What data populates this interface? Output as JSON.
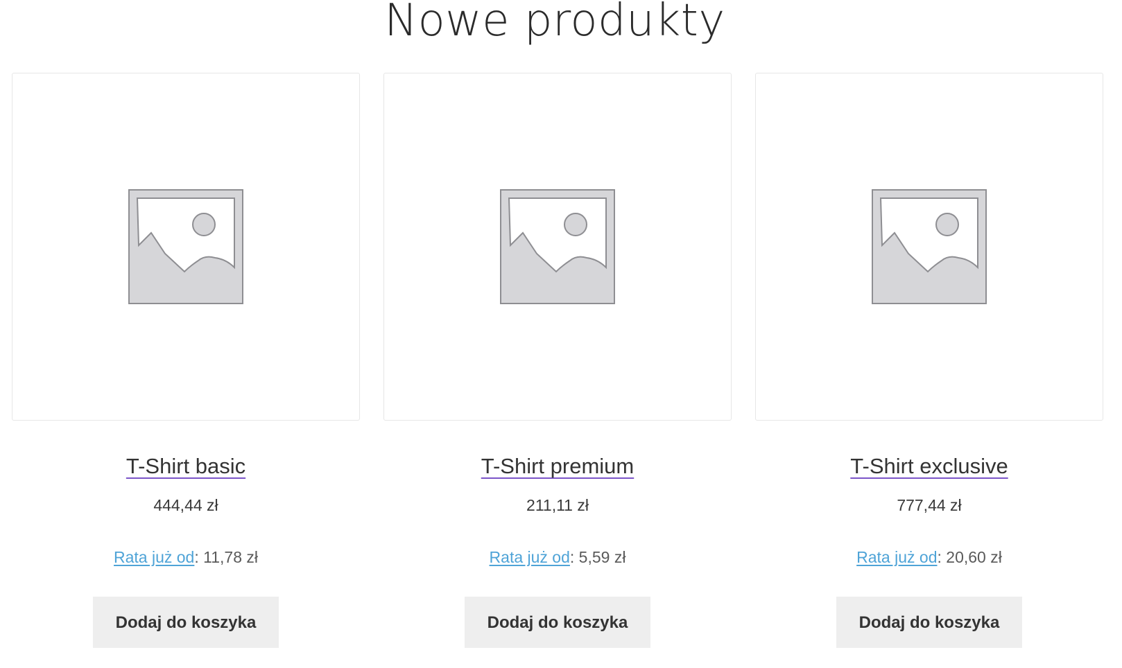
{
  "section": {
    "title": "Nowe produkty"
  },
  "products": [
    {
      "name": "T-Shirt basic",
      "price": "444,44 zł",
      "installment_label": "Rata już od",
      "installment_value": ": 11,78 zł",
      "button_label": "Dodaj do koszyka",
      "image_icon": "image-placeholder-icon"
    },
    {
      "name": "T-Shirt premium",
      "price": "211,11 zł",
      "installment_label": "Rata już od",
      "installment_value": ": 5,59 zł",
      "button_label": "Dodaj do koszyka",
      "image_icon": "image-placeholder-icon"
    },
    {
      "name": "T-Shirt exclusive",
      "price": "777,44 zł",
      "installment_label": "Rata już od",
      "installment_value": ": 20,60 zł",
      "button_label": "Dodaj do koszyka",
      "image_icon": "image-placeholder-icon"
    }
  ],
  "colors": {
    "title_underline": "#7b54c8",
    "installment_link": "#4ea3d7",
    "button_bg": "#eeeeee",
    "text": "#333333"
  }
}
